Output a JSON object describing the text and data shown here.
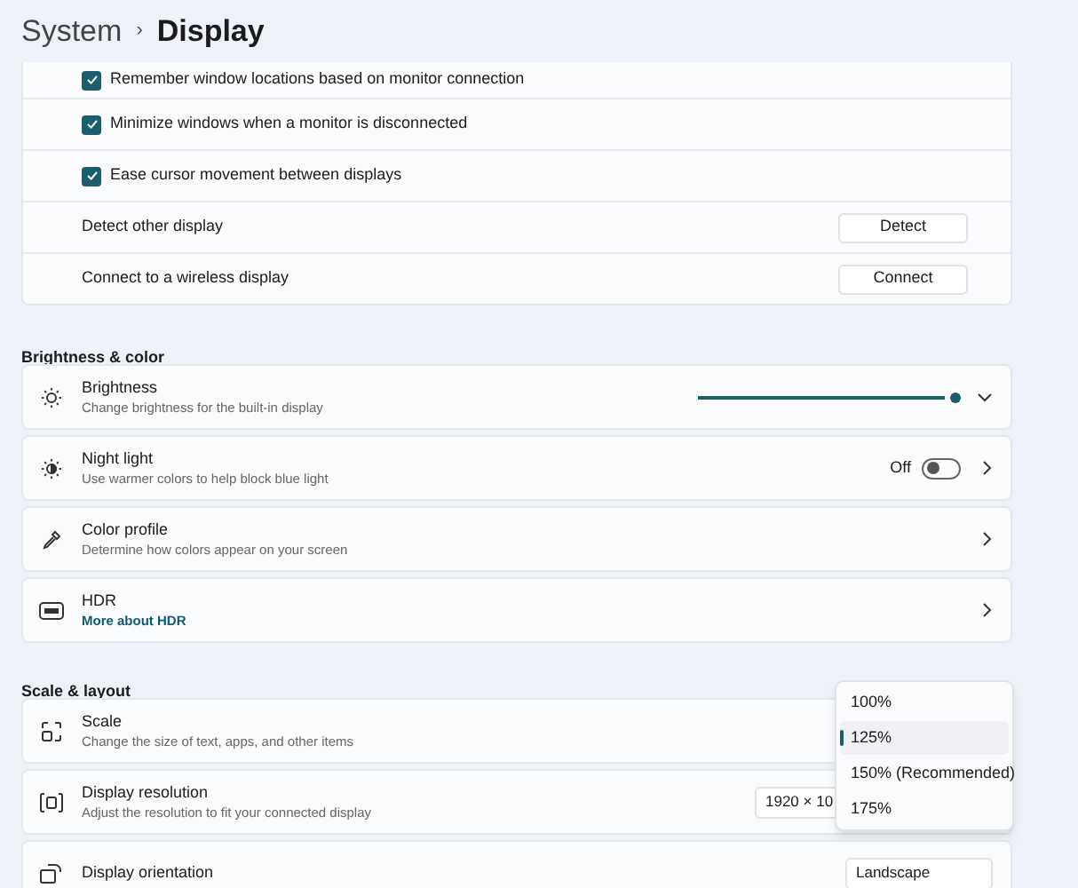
{
  "header": {
    "breadcrumb": "System",
    "separator": "›",
    "title": "Display"
  },
  "display_options": [
    {
      "kind": "checkbox",
      "label": "Remember window locations based on monitor connection",
      "checked": true
    },
    {
      "kind": "checkbox",
      "label": "Minimize windows when a monitor is disconnected",
      "checked": true
    },
    {
      "kind": "checkbox",
      "label": "Ease cursor movement between displays",
      "checked": true
    },
    {
      "kind": "button",
      "label": "Detect other display",
      "button": "Detect"
    },
    {
      "kind": "button",
      "label": "Connect to a wireless display",
      "button": "Connect"
    }
  ],
  "brightness_color": {
    "heading": "Brightness & color",
    "cards": [
      {
        "kind": "slider",
        "title": "Brightness",
        "subtitle": "Change brightness for the built-in display",
        "level": 1,
        "expanded": false
      },
      {
        "kind": "toggle",
        "title": "Night light",
        "subtitle": "Use warmer colors to help block blue light",
        "state": "Off",
        "on": false
      },
      {
        "kind": "nav",
        "title": "Color profile",
        "subtitle": "Determine how colors appear on your screen"
      },
      {
        "kind": "nav",
        "title": "HDR",
        "link": "More about HDR"
      }
    ]
  },
  "scale_layout": {
    "heading": "Scale & layout",
    "cards": [
      {
        "kind": "menu",
        "title": "Scale",
        "subtitle": "Change the size of text, apps, and other items"
      },
      {
        "kind": "combo",
        "title": "Display resolution",
        "subtitle": "Adjust the resolution to fit your connected display",
        "value": "1920 × 10"
      },
      {
        "kind": "combo",
        "title": "Display orientation",
        "value": "Landscape"
      }
    ]
  },
  "scale_menu": {
    "options": [
      {
        "label": "100%",
        "selected": false
      },
      {
        "label": "125%",
        "selected": true
      },
      {
        "label": "150% (Recommended)",
        "selected": false
      },
      {
        "label": "175%",
        "selected": false
      }
    ]
  }
}
